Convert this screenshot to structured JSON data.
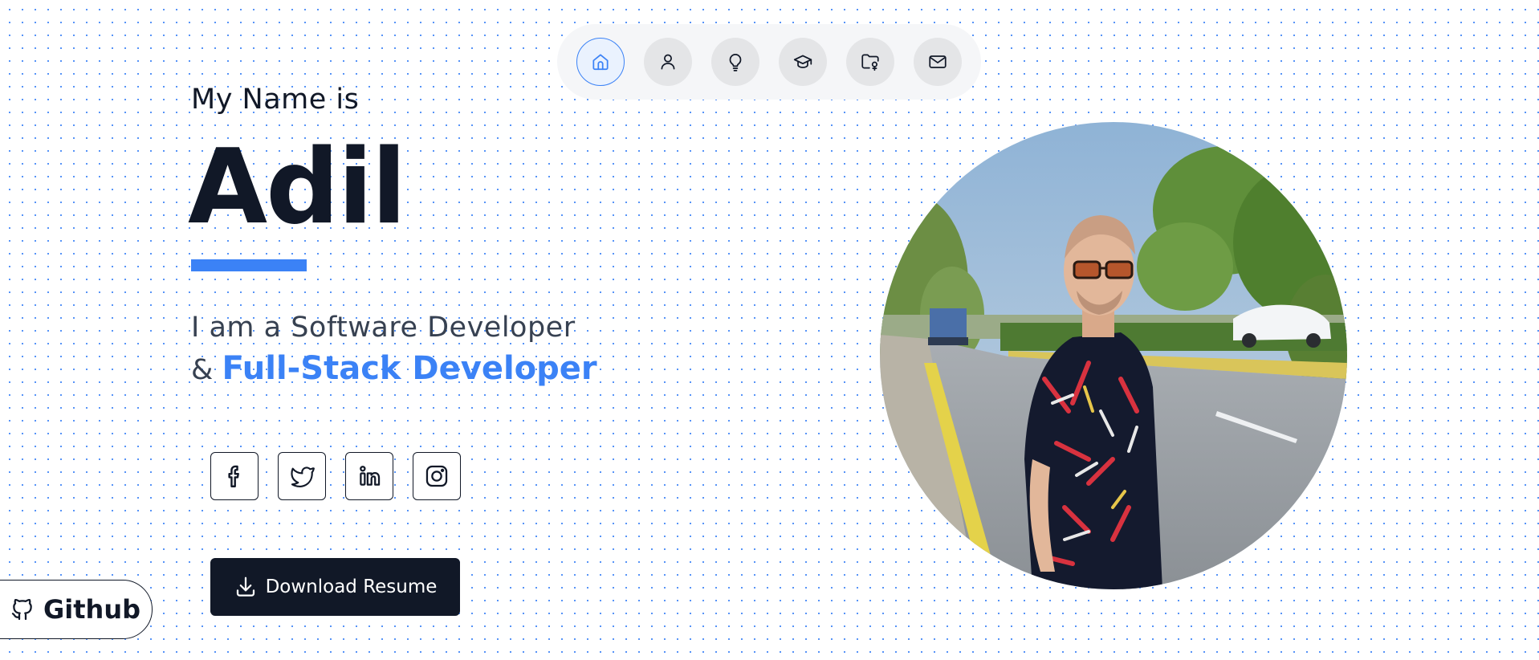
{
  "nav": {
    "items": [
      {
        "icon": "home-icon",
        "active": true
      },
      {
        "icon": "user-icon",
        "active": false
      },
      {
        "icon": "lightbulb-icon",
        "active": false
      },
      {
        "icon": "graduation-cap-icon",
        "active": false
      },
      {
        "icon": "folder-code-icon",
        "active": false
      },
      {
        "icon": "mail-icon",
        "active": false
      }
    ]
  },
  "hero": {
    "intro": "My Name is",
    "name": "Adil",
    "tagline_line1": "I am a Software Developer",
    "tagline_prefix": "&",
    "tagline_highlight": "Full-Stack Developer"
  },
  "socials": [
    {
      "icon": "facebook-icon"
    },
    {
      "icon": "twitter-icon"
    },
    {
      "icon": "linkedin-icon"
    },
    {
      "icon": "instagram-icon"
    }
  ],
  "download_button": {
    "label": "Download Resume",
    "icon": "download-icon"
  },
  "github_button": {
    "label": "Github",
    "icon": "github-icon"
  },
  "colors": {
    "accent": "#3b82f6",
    "dark": "#111827"
  }
}
